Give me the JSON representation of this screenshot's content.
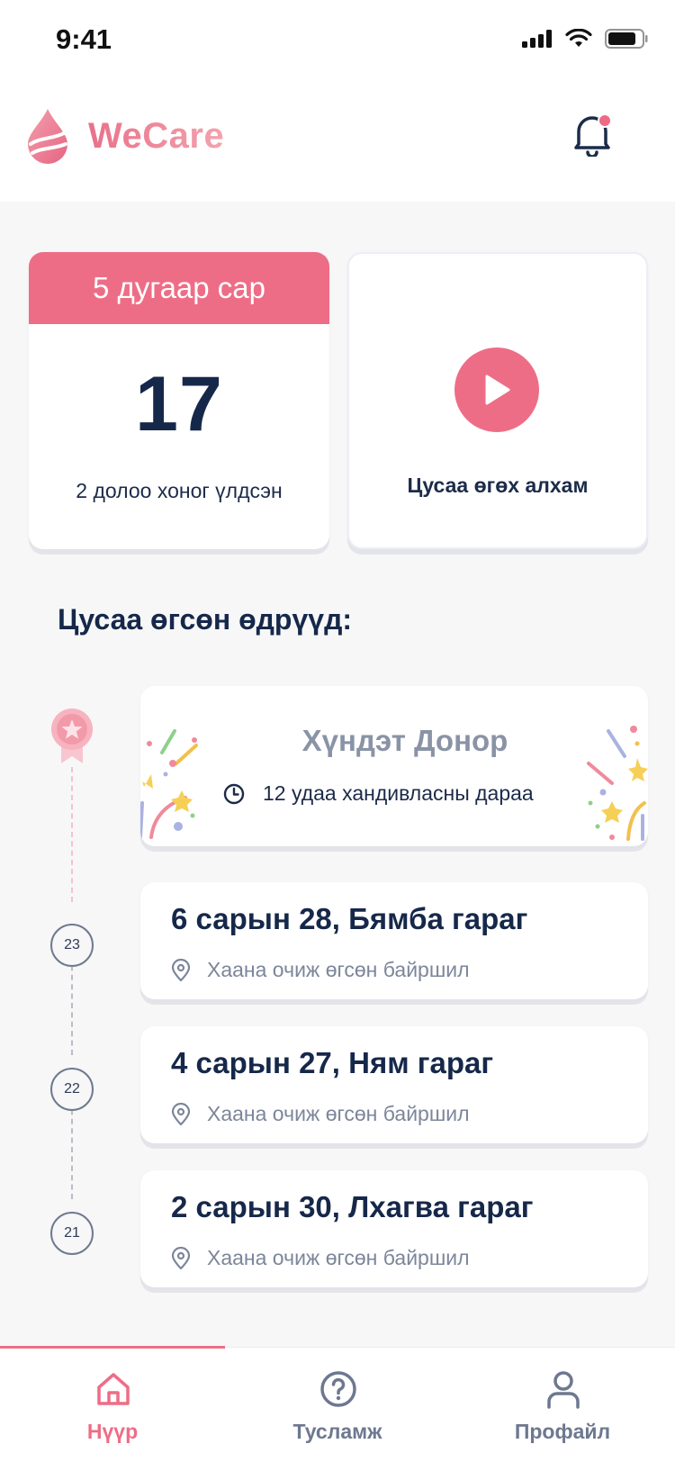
{
  "status_bar": {
    "time": "9:41"
  },
  "header": {
    "app_name": "WeCare",
    "bell_icon": "bell-icon"
  },
  "date_card": {
    "month": "5 дугаар сар",
    "day": "17",
    "remaining": "2 долоо хоног үлдсэн"
  },
  "steps_card": {
    "label": "Цусаа өгөх алхам",
    "icon": "play-icon"
  },
  "section_title": "Цусаа өгсөн өдрүүд:",
  "donor_card": {
    "title": "Хүндэт Донор",
    "subtitle": "12 удаа хандивласны дараа",
    "icon": "medal-icon"
  },
  "donations": [
    {
      "number": "23",
      "date": "6 сарын 28, Бямба гараг",
      "location": "Хаана очиж өгсөн байршил"
    },
    {
      "number": "22",
      "date": "4 сарын 27, Ням гараг",
      "location": "Хаана очиж өгсөн байршил"
    },
    {
      "number": "21",
      "date": "2 сарын 30, Лхагва гараг",
      "location": "Хаана очиж өгсөн байршил"
    }
  ],
  "tabs": [
    {
      "label": "Нүүр",
      "icon": "home-icon",
      "active": true
    },
    {
      "label": "Тусламж",
      "icon": "help-icon",
      "active": false
    },
    {
      "label": "Профайл",
      "icon": "profile-icon",
      "active": false
    }
  ],
  "colors": {
    "accent": "#ee6d86",
    "text_dark": "#16284a",
    "text_muted": "#7c869a"
  }
}
